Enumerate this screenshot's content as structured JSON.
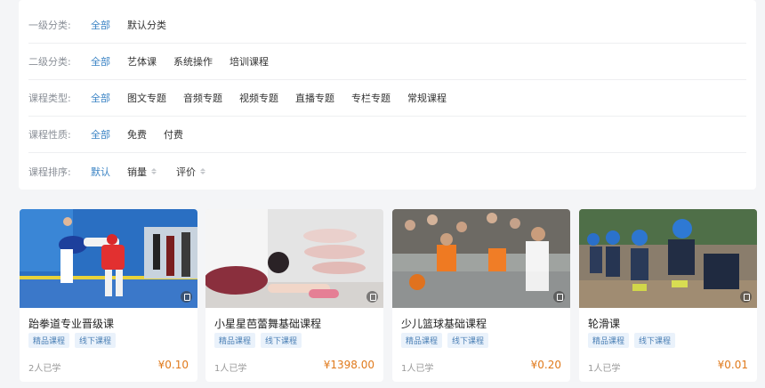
{
  "filters": [
    {
      "label": "一级分类:",
      "options": [
        "全部",
        "默认分类"
      ],
      "active": 0
    },
    {
      "label": "二级分类:",
      "options": [
        "全部",
        "艺体课",
        "系统操作",
        "培训课程"
      ],
      "active": 0
    },
    {
      "label": "课程类型:",
      "options": [
        "全部",
        "图文专题",
        "音频专题",
        "视频专题",
        "直播专题",
        "专栏专题",
        "常规课程"
      ],
      "active": 0
    },
    {
      "label": "课程性质:",
      "options": [
        "全部",
        "免费",
        "付费"
      ],
      "active": 0
    },
    {
      "label": "课程排序:",
      "options": [
        "默认",
        "销量",
        "评价"
      ],
      "active": 0
    }
  ],
  "cards": [
    {
      "title": "跆拳道专业晋级课",
      "tags": [
        "精品课程",
        "线下课程"
      ],
      "learners": "2人已学",
      "price": "¥0.10"
    },
    {
      "title": "小星星芭蕾舞基础课程",
      "tags": [
        "精品课程",
        "线下课程"
      ],
      "learners": "1人已学",
      "price": "¥1398.00"
    },
    {
      "title": "少儿篮球基础课程",
      "tags": [
        "精品课程",
        "线下课程"
      ],
      "learners": "1人已学",
      "price": "¥0.20"
    },
    {
      "title": "轮滑课",
      "tags": [
        "精品课程",
        "线下课程"
      ],
      "learners": "1人已学",
      "price": "¥0.01"
    }
  ],
  "colors": {
    "accent": "#3a83c4",
    "price": "#e07a1c",
    "tag_bg": "#eaf2fb"
  }
}
